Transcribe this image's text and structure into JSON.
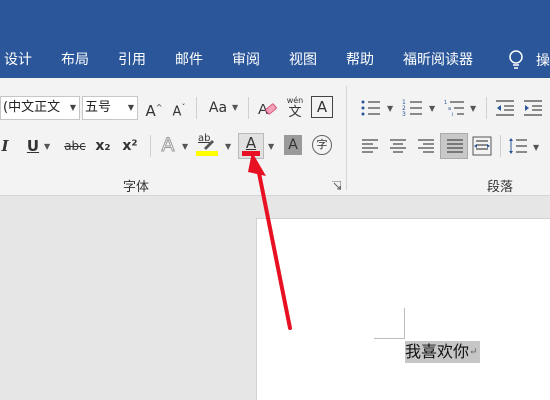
{
  "tabs": [
    {
      "label": "设计"
    },
    {
      "label": "布局"
    },
    {
      "label": "引用"
    },
    {
      "label": "邮件"
    },
    {
      "label": "审阅"
    },
    {
      "label": "视图"
    },
    {
      "label": "帮助"
    },
    {
      "label": "福昕阅读器"
    }
  ],
  "tell_me": {
    "label": "操"
  },
  "font_group": {
    "label": "字体",
    "font_name": "(中文正文",
    "font_size": "五号",
    "grow_font": "A",
    "shrink_font": "A",
    "change_case": "Aa",
    "phonetic_top": "wén",
    "phonetic_bottom": "文",
    "char_border": "A",
    "italic": "I",
    "underline": "U",
    "strike": "abc",
    "subscript": "x₂",
    "superscript": "x²",
    "text_effect": "A",
    "highlight": "ab",
    "font_color": "A",
    "char_shading": "A",
    "enclose": "字",
    "font_color_value": "#e81123",
    "highlight_color_value": "#ffff00"
  },
  "paragraph_group": {
    "label": "段落"
  },
  "document": {
    "text": "我喜欢你",
    "para_mark": "↵"
  },
  "annotation": {
    "arrow_color": "#e81123"
  }
}
